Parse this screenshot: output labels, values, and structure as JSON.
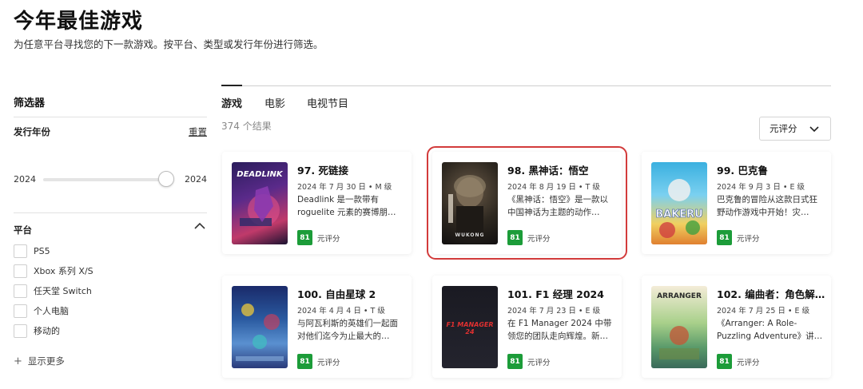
{
  "header": {
    "title": "今年最佳游戏",
    "subtitle": "为任意平台寻找您的下一款游戏。按平台、类型或发行年份进行筛选。"
  },
  "sidebar": {
    "heading": "筛选器",
    "year_label": "发行年份",
    "reset_label": "重置",
    "year_min": "2024",
    "year_max": "2024",
    "platform_label": "平台",
    "platforms": [
      {
        "label": "PS5"
      },
      {
        "label": "Xbox 系列 X/S"
      },
      {
        "label": "任天堂 Switch"
      },
      {
        "label": "个人电脑"
      },
      {
        "label": "移动的"
      }
    ],
    "show_more_label": "显示更多"
  },
  "main": {
    "tabs": [
      {
        "label": "游戏"
      },
      {
        "label": "电影"
      },
      {
        "label": "电视节目"
      }
    ],
    "result_count": "374 个结果",
    "sort_label": "元评分"
  },
  "cards": [
    {
      "title": "97. 死链接",
      "meta": "2024 年 7 月 30 日 • M 级",
      "description": "Deadlink 是一款带有 roguelite 元素的赛博朋…",
      "score": "81",
      "score_label": "元评分",
      "cover_text": "DEADLINK"
    },
    {
      "title": "98. 黑神话：悟空",
      "meta": "2024 年 8 月 19 日 • T 级",
      "description": "《黑神话：悟空》是一款以中国神话为主题的动作…",
      "score": "81",
      "score_label": "元评分",
      "cover_text": "WUKONG"
    },
    {
      "title": "99. 巴克鲁",
      "meta": "2024 年 9 月 3 日 • E 级",
      "description": "巴克鲁的冒险从这款日式狂野动作游戏中开始！灾…",
      "score": "81",
      "score_label": "元评分",
      "cover_text": "BAKERU"
    },
    {
      "title": "100. 自由星球 2",
      "meta": "2024 年 4 月 4 日 • T 级",
      "description": "与阿瓦利斯的英雄们一起面对他们迄今为止最大的…",
      "score": "81",
      "score_label": "元评分",
      "cover_text": ""
    },
    {
      "title": "101. F1 经理 2024",
      "meta": "2024 年 7 月 23 日 • E 级",
      "description": "在 F1 Manager 2024 中带领您的团队走向辉煌。新…",
      "score": "81",
      "score_label": "元评分",
      "cover_text": "F1 MANAGER 24"
    },
    {
      "title": "102. 编曲者：角色解…",
      "meta": "2024 年 7 月 25 日 • E 级",
      "description": "《Arranger: A Role-Puzzling Adventure》讲…",
      "score": "81",
      "score_label": "元评分",
      "cover_text": "ARRANGER"
    }
  ],
  "colors": {
    "score_green": "#1c9c39",
    "highlight_red": "#d23b3b",
    "accent_dark": "#111111"
  }
}
